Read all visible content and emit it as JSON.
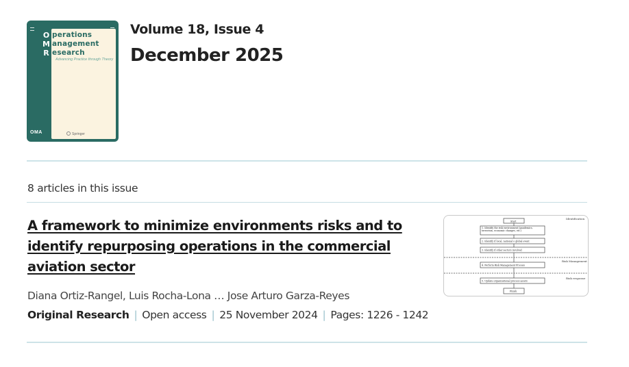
{
  "issue": {
    "volume_issue": "Volume 18, Issue 4",
    "date": "December 2025",
    "article_count": "8 articles in this issue"
  },
  "cover": {
    "title_lines": [
      "perations",
      "anagement",
      "esearch"
    ],
    "big_letters": [
      "O",
      "M",
      "R"
    ],
    "tagline": "Advancing Practice through Theory",
    "oma_logo": "OMA",
    "publisher": "Springer",
    "colors": {
      "frame": "#2a6b63",
      "panel": "#fbf3e0"
    }
  },
  "article": {
    "title": "A framework to minimize environments risks and to identify repurposing operations in the commercial aviation sector",
    "authors": "Diana Ortiz-Rangel, Luis Rocha-Lona … Jose Arturo Garza-Reyes",
    "type": "Original Research",
    "access": "Open access",
    "published": "25 November 2024",
    "pages": "Pages: 1226 - 1242"
  },
  "figure": {
    "side_labels": [
      "Identification",
      "Risk Management",
      "Risk response"
    ],
    "boxes": [
      "Start",
      "1. Identify the risk environment (pandemics, terrorism, economic changes, etc.)",
      "2. Identify if local, national o global event",
      "3. Identify if other sectors involved",
      "4. Perform Risk Management Process",
      "5. Update organizational process assets",
      "Finish"
    ]
  },
  "colors": {
    "divider": "#c5dde3",
    "separator": "#9cc3cc",
    "text": "#222222"
  }
}
